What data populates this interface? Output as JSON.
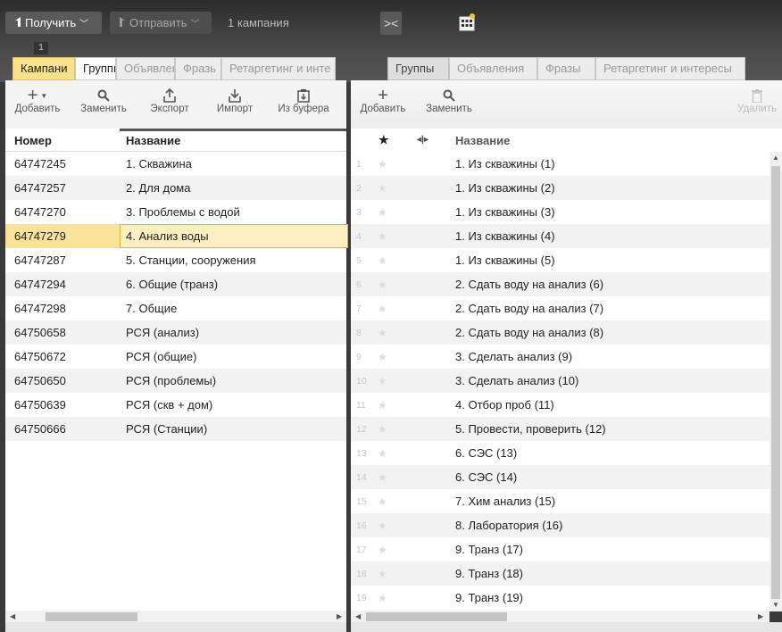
{
  "toolbar_top": {
    "get_label": "Получить",
    "send_label": "Отправить",
    "campaign_count": "1 кампания",
    "badge": "1"
  },
  "left": {
    "tabs": [
      "Кампани",
      "Группь",
      "Объявлен",
      "Фразь",
      "Ретаргетинг и инте"
    ],
    "tools": [
      "Добавить",
      "Заменить",
      "Экспорт",
      "Импорт",
      "Из буфера"
    ],
    "columns": {
      "id": "Номер",
      "name": "Название"
    },
    "rows": [
      {
        "id": "64747245",
        "name": "1. Скважина"
      },
      {
        "id": "64747257",
        "name": "2. Для дома"
      },
      {
        "id": "64747270",
        "name": "3. Проблемы с водой"
      },
      {
        "id": "64747279",
        "name": "4. Анализ воды"
      },
      {
        "id": "64747287",
        "name": "5. Станции, сооружения"
      },
      {
        "id": "64747294",
        "name": "6. Общие (транз)"
      },
      {
        "id": "64747298",
        "name": "7. Общие"
      },
      {
        "id": "64750658",
        "name": "РСЯ (анализ)"
      },
      {
        "id": "64750672",
        "name": "РСЯ (общие)"
      },
      {
        "id": "64750650",
        "name": "РСЯ (проблемы)"
      },
      {
        "id": "64750639",
        "name": "РСЯ (скв + дом)"
      },
      {
        "id": "64750666",
        "name": "РСЯ (Станции)"
      }
    ]
  },
  "right": {
    "tabs": [
      "Группы",
      "Объявления",
      "Фразы",
      "Ретаргетинг и интересы"
    ],
    "tools": [
      "Добавить",
      "Заменить",
      "Удалить"
    ],
    "columns": {
      "name": "Название"
    },
    "rows": [
      {
        "n": "1",
        "name": "1. Из скважины (1)"
      },
      {
        "n": "2",
        "name": "1. Из скважины (2)"
      },
      {
        "n": "3",
        "name": "1. Из скважины (3)"
      },
      {
        "n": "4",
        "name": "1. Из скважины (4)"
      },
      {
        "n": "5",
        "name": "1. Из скважины (5)"
      },
      {
        "n": "6",
        "name": "2. Сдать воду на анализ (6)"
      },
      {
        "n": "7",
        "name": "2. Сдать воду на анализ (7)"
      },
      {
        "n": "8",
        "name": "2. Сдать воду на анализ (8)"
      },
      {
        "n": "9",
        "name": "3. Сделать анализ (9)"
      },
      {
        "n": "10",
        "name": "3. Сделать анализ (10)"
      },
      {
        "n": "11",
        "name": "4. Отбор проб (11)"
      },
      {
        "n": "12",
        "name": "5. Провести, проверить (12)"
      },
      {
        "n": "13",
        "name": "6. СЭС (13)"
      },
      {
        "n": "14",
        "name": "6. СЭС (14)"
      },
      {
        "n": "15",
        "name": "7. Хим анализ (15)"
      },
      {
        "n": "16",
        "name": "8. Лаборатория (16)"
      },
      {
        "n": "17",
        "name": "9. Транз (17)"
      },
      {
        "n": "18",
        "name": "9. Транз (18)"
      },
      {
        "n": "19",
        "name": "9. Транз (19)"
      }
    ]
  }
}
